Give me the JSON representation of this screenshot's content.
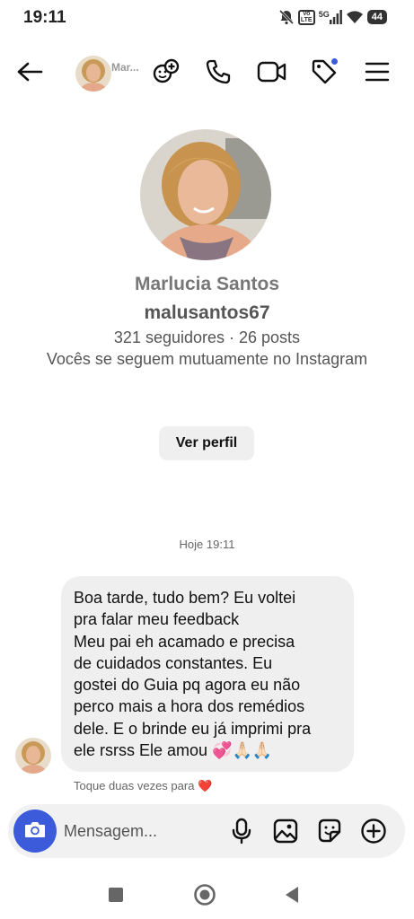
{
  "status_bar": {
    "time": "19:11",
    "network_badge": "Vo LTE",
    "network_type": "5G",
    "battery": "44",
    "icons": [
      "mute-bell-icon",
      "volte-icon",
      "signal-icon",
      "wifi-icon",
      "battery-icon"
    ]
  },
  "header": {
    "contact_short_name": "Mar...",
    "icons": [
      "back-arrow-icon",
      "add-people-icon",
      "phone-icon",
      "video-icon",
      "tag-icon",
      "menu-icon"
    ],
    "accent_color": "#3b5bdb"
  },
  "profile": {
    "name": "Marlucia Santos",
    "username": "malusantos67",
    "stats": "321 seguidores · 26 posts",
    "mutual": "Vocês se seguem mutuamente no Instagram",
    "view_profile_label": "Ver perfil"
  },
  "messages": {
    "timestamp": "Hoje 19:11",
    "lines": [
      "Boa tarde, tudo bem? Eu voltei",
      "pra falar meu feedback",
      "Meu pai eh acamado e precisa",
      "de cuidados constantes. Eu",
      "gostei do Guia pq agora eu não",
      "perco mais a hora dos remédios",
      "dele. E o brinde eu já imprimi pra",
      "ele rsrss Ele amou 💞🙏🏻🙏🏻"
    ],
    "reaction_hint": "Toque duas vezes para ❤️"
  },
  "composer": {
    "placeholder": "Mensagem...",
    "icons": [
      "camera-icon",
      "microphone-icon",
      "gallery-icon",
      "sticker-icon",
      "plus-icon"
    ]
  },
  "navbar": {
    "icons": [
      "recents-icon",
      "home-icon",
      "back-icon"
    ]
  },
  "colors": {
    "bubble": "#efefef",
    "camera_button": "#3b5bdb",
    "muted_text": "#666666"
  }
}
